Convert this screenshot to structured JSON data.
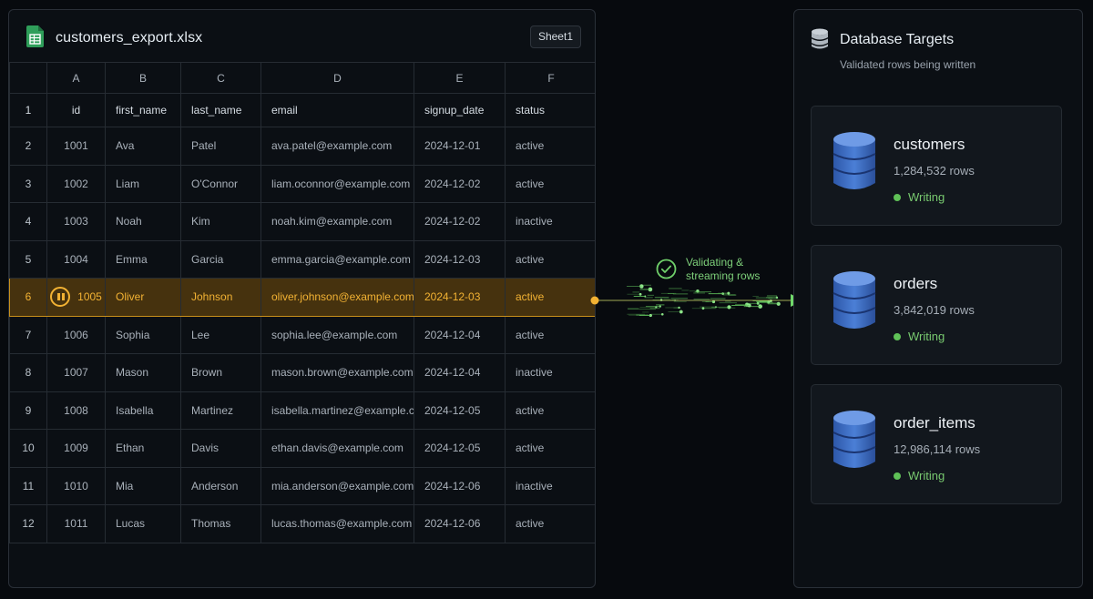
{
  "file": {
    "title": "customers_export.xlsx",
    "sheet_tab": "Sheet1",
    "icon": "spreadsheet-icon"
  },
  "grid": {
    "column_letters": [
      "A",
      "B",
      "C",
      "D",
      "E",
      "F"
    ],
    "header_row_number": "1",
    "headers": [
      "id",
      "first_name",
      "last_name",
      "email",
      "signup_date",
      "status"
    ],
    "rows": [
      {
        "n": "2",
        "cells": [
          "1001",
          "Ava",
          "Patel",
          "ava.patel@example.com",
          "2024-12-01",
          "active"
        ]
      },
      {
        "n": "3",
        "cells": [
          "1002",
          "Liam",
          "O'Connor",
          "liam.oconnor@example.com",
          "2024-12-02",
          "active"
        ]
      },
      {
        "n": "4",
        "cells": [
          "1003",
          "Noah",
          "Kim",
          "noah.kim@example.com",
          "2024-12-02",
          "inactive"
        ]
      },
      {
        "n": "5",
        "cells": [
          "1004",
          "Emma",
          "Garcia",
          "emma.garcia@example.com",
          "2024-12-03",
          "active"
        ]
      },
      {
        "n": "6",
        "cells": [
          "1005",
          "Oliver",
          "Johnson",
          "oliver.johnson@example.com",
          "2024-12-03",
          "active"
        ],
        "active": true
      },
      {
        "n": "7",
        "cells": [
          "1006",
          "Sophia",
          "Lee",
          "sophia.lee@example.com",
          "2024-12-04",
          "active"
        ]
      },
      {
        "n": "8",
        "cells": [
          "1007",
          "Mason",
          "Brown",
          "mason.brown@example.com",
          "2024-12-04",
          "inactive"
        ]
      },
      {
        "n": "9",
        "cells": [
          "1008",
          "Isabella",
          "Martinez",
          "isabella.martinez@example.com",
          "2024-12-05",
          "active"
        ]
      },
      {
        "n": "10",
        "cells": [
          "1009",
          "Ethan",
          "Davis",
          "ethan.davis@example.com",
          "2024-12-05",
          "active"
        ]
      },
      {
        "n": "11",
        "cells": [
          "1010",
          "Mia",
          "Anderson",
          "mia.anderson@example.com",
          "2024-12-06",
          "inactive"
        ]
      },
      {
        "n": "12",
        "cells": [
          "1011",
          "Lucas",
          "Thomas",
          "lucas.thomas@example.com",
          "2024-12-06",
          "active"
        ]
      }
    ]
  },
  "stream": {
    "label_line1": "Validating &",
    "label_line2": "streaming rows",
    "icon": "check-circle-icon"
  },
  "targets": {
    "title": "Database Targets",
    "subtitle": "Validated rows being written",
    "icon": "database-icon",
    "items": [
      {
        "name": "customers",
        "rows": "1,284,532 rows",
        "status": "Writing"
      },
      {
        "name": "orders",
        "rows": "3,842,019 rows",
        "status": "Writing"
      },
      {
        "name": "order_items",
        "rows": "12,986,114 rows",
        "status": "Writing"
      }
    ]
  },
  "colors": {
    "accent": "#f2b233",
    "success": "#5fc157",
    "db_blue": "#3f6fc4"
  }
}
